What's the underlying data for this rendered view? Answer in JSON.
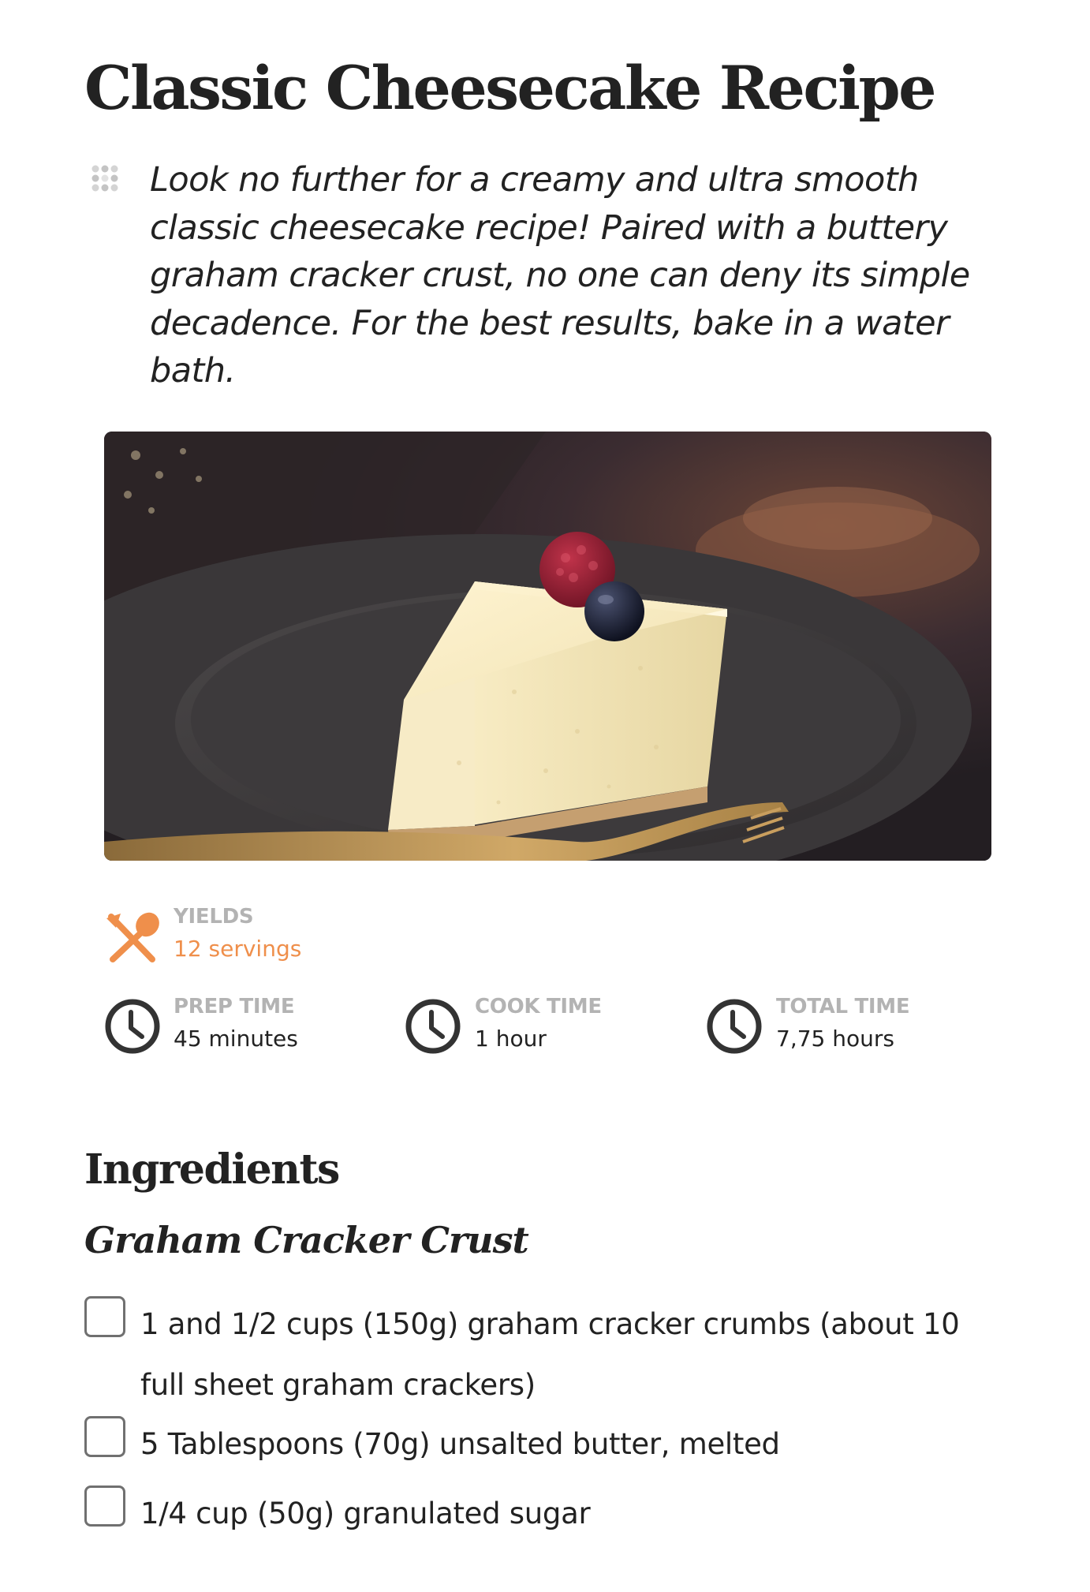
{
  "recipe": {
    "title": "Classic Cheesecake Recipe",
    "description": "Look no further for a creamy and ultra smooth classic cheesecake recipe! Paired with a buttery graham cracker crust, no one can deny its simple decadence. For the best results, bake in a water bath.",
    "image_alt": "Slice of cheesecake topped with a raspberry and a blueberry on a dark plate with a gold fork"
  },
  "meta": {
    "yields": {
      "label": "YIELDS",
      "value": "12 servings",
      "icon": "fork-spoon-icon"
    },
    "prep": {
      "label": "PREP TIME",
      "value": "45 minutes",
      "icon": "clock-icon"
    },
    "cook": {
      "label": "COOK TIME",
      "value": "1 hour",
      "icon": "clock-icon"
    },
    "total": {
      "label": "TOTAL TIME",
      "value": "7,75 hours",
      "icon": "clock-icon"
    }
  },
  "ingredients": {
    "heading": "Ingredients",
    "groups": [
      {
        "title": "Graham Cracker Crust",
        "items": [
          {
            "line1": "1 and 1/2 cups (150g) graham cracker crumbs (about 10",
            "line2": "full sheet graham crackers)",
            "checked": false
          },
          {
            "line1": "5 Tablespoons (70g) unsalted butter, melted",
            "checked": false
          },
          {
            "line1": "1/4 cup (50g) granulated sugar",
            "checked": false
          }
        ]
      }
    ]
  },
  "colors": {
    "accent": "#ef8f4b",
    "label_gray": "#b3b3b3",
    "text": "#222222",
    "icon_dark": "#333333"
  }
}
